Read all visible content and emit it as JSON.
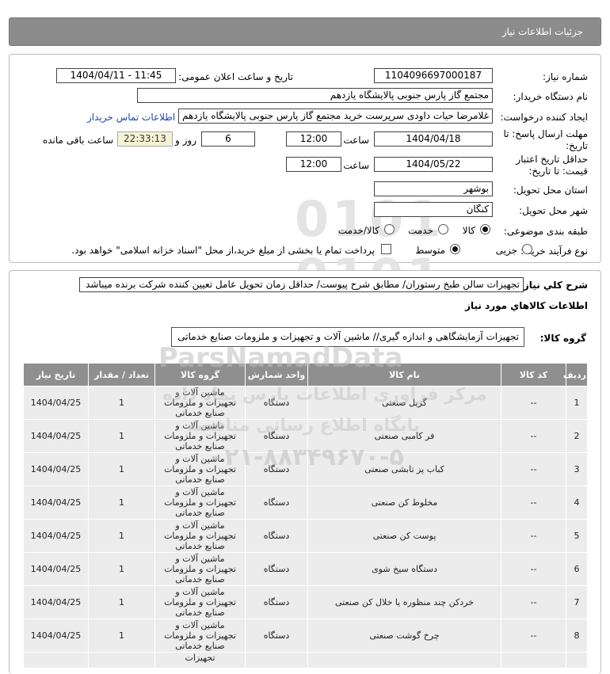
{
  "header": {
    "title": "جزئیات اطلاعات نیاز"
  },
  "form": {
    "need_number_label": "شماره نیاز:",
    "need_number": "1104096697000187",
    "announce_label": "تاریخ و ساعت اعلان عمومی:",
    "announce_value": "1404/04/11 - 11:45",
    "buyer_label": "نام دستگاه خریدار:",
    "buyer_value": "مجتمع گاز پارس جنوبی  پالایشگاه یازدهم",
    "creator_label": "ایجاد کننده درخواست:",
    "creator_value": "غلامرضا حیات داودی سرپرست خرید مجتمع گاز پارس جنوبی  پالایشگاه یازدهم",
    "contact_link": "اطلاعات تماس خریدار",
    "deadline_label": "مهلت ارسال پاسخ: تا تاریخ:",
    "deadline_date": "1404/04/18",
    "time_label": "ساعت",
    "deadline_time": "12:00",
    "days_value": "6",
    "days_label": "روز و",
    "remaining_value": "22:33:13",
    "remaining_label": "ساعت باقی مانده",
    "validity_label": "حداقل تاریخ اعتبار قیمت: تا تاریخ:",
    "validity_date": "1404/05/22",
    "validity_time": "12:00",
    "province_label": "استان محل تحویل:",
    "province_value": "بوشهر",
    "city_label": "شهر محل تحویل:",
    "city_value": "کنگان",
    "category_label": "طبقه بندی موضوعی:",
    "category_options": [
      "کالا",
      "خدمت",
      "کالا/خدمت"
    ],
    "purchase_label": "نوع فرآیند خرید :",
    "purchase_options": [
      "جزیی",
      "متوسط"
    ],
    "payment_note": "پرداخت تمام یا بخشی از مبلغ خرید،از محل \"اسناد خزانه اسلامی\" خواهد بود."
  },
  "description": {
    "label": "شرح کلي نياز:",
    "value": "تجهیزات سالن طبخ رستوران/ مطابق شرح پیوست/ حداقل زمان تحویل عامل تعیین کننده شرکت برنده میباشد",
    "goods_info_title": "اطلاعات کالاهاي مورد نياز",
    "group_label": "گروه کالا:",
    "group_value": "تجهیزات آزمایشگاهی و اندازه گیری// ماشین آلات و تجهیزات و ملزومات صنایع خدماتی"
  },
  "table": {
    "headers": [
      "ردیف",
      "کد کالا",
      "نام کالا",
      "واحد شمارش",
      "گروه کالا",
      "تعداد / مقدار",
      "تاریخ نیاز"
    ],
    "rows": [
      [
        "1",
        "--",
        "گریل صنعتی",
        "دستگاه",
        "ماشین آلات و تجهیزات و ملزومات صنایع خدماتی",
        "1",
        "1404/04/25"
      ],
      [
        "2",
        "--",
        "فر کامبی صنعتی",
        "دستگاه",
        "ماشین آلات و تجهیزات و ملزومات صنایع خدماتی",
        "1",
        "1404/04/25"
      ],
      [
        "3",
        "--",
        "کباب پز تابشی صنعتی",
        "دستگاه",
        "ماشین آلات و تجهیزات و ملزومات صنایع خدماتی",
        "1",
        "1404/04/25"
      ],
      [
        "4",
        "--",
        "مخلوط کن صنعتی",
        "دستگاه",
        "ماشین آلات و تجهیزات و ملزومات صنایع خدماتی",
        "1",
        "1404/04/25"
      ],
      [
        "5",
        "--",
        "پوست کن صنعتی",
        "دستگاه",
        "ماشین آلات و تجهیزات و ملزومات صنایع خدماتی",
        "1",
        "1404/04/25"
      ],
      [
        "6",
        "--",
        "دستگاه سیخ شوی",
        "دستگاه",
        "ماشین آلات و تجهیزات و ملزومات صنایع خدماتی",
        "1",
        "1404/04/25"
      ],
      [
        "7",
        "--",
        "خردکن چند منظوره یا خلال کن صنعتی",
        "دستگاه",
        "ماشین آلات و تجهیزات و ملزومات صنایع خدماتی",
        "1",
        "1404/04/25"
      ],
      [
        "8",
        "--",
        "چرخ گوشت صنعتی",
        "دستگاه",
        "ماشین آلات و تجهیزات و ملزومات صنایع خدماتی",
        "1",
        "1404/04/25"
      ],
      [
        "",
        "",
        "",
        "",
        "تجهیزات",
        "",
        ""
      ]
    ]
  },
  "watermarks": {
    "brand": "ParsNamadData",
    "center_text": "مرکز فراوری اطلاعات پارس نماد داده",
    "portal_text": "پایگاه اطلاع رسانی مناقصه",
    "phone": "۰۲۱-۸۸۳۴۹۶۷۰-۵"
  }
}
